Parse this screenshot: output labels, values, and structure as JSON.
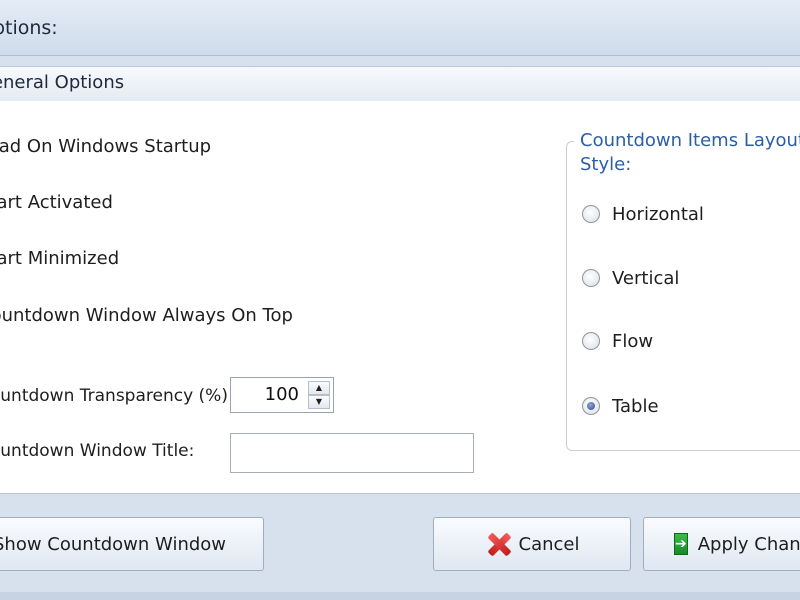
{
  "window": {
    "title": "Options:"
  },
  "section": {
    "title": "General Options"
  },
  "options": {
    "load_on_startup": "Load On Windows Startup",
    "start_activated": "Start Activated",
    "start_minimized": "Start Minimized",
    "always_on_top": "Countdown Window Always On Top"
  },
  "fields": {
    "transparency_label": "Countdown Transparency (%):",
    "transparency_value": "100",
    "title_label": "Countdown Window Title:",
    "title_value": ""
  },
  "layout_group": {
    "title": "Countdown Items Layout Style:",
    "options": [
      {
        "label": "Horizontal",
        "checked": false
      },
      {
        "label": "Vertical",
        "checked": false
      },
      {
        "label": "Flow",
        "checked": false
      },
      {
        "label": "Table",
        "checked": true
      }
    ]
  },
  "buttons": {
    "show": "Show Countdown Window",
    "cancel": "Cancel",
    "apply": "Apply Changes"
  },
  "icons": {
    "cancel": "red-x-icon",
    "apply": "green-arrow-icon",
    "spin_up": "triangle-up-icon",
    "spin_down": "triangle-down-icon"
  },
  "colors": {
    "accent_text": "#2a5ea8",
    "window_bg": "#d7e1ee"
  }
}
